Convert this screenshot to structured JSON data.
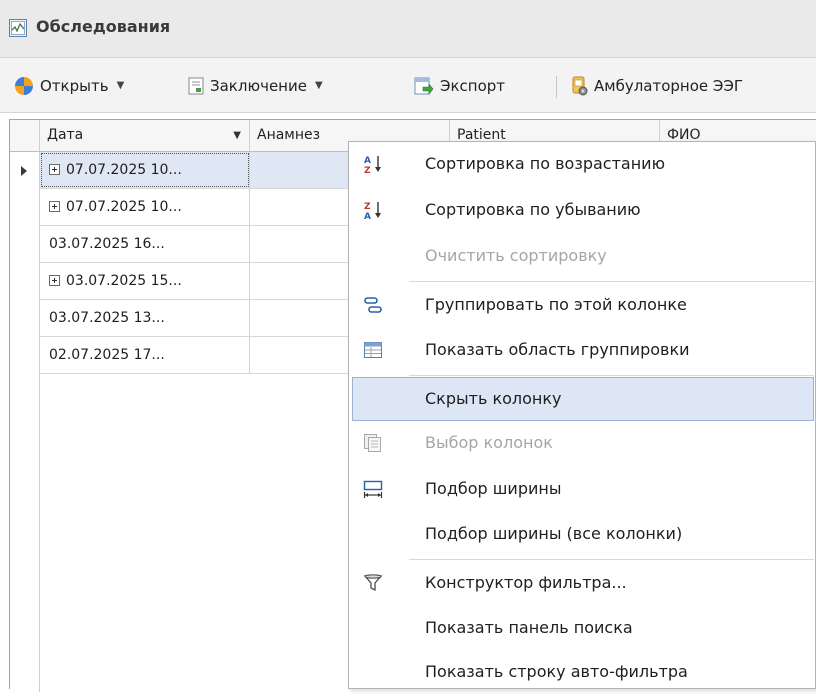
{
  "window": {
    "title": "Обследования",
    "title_icon": "examination-window-icon"
  },
  "toolbar": {
    "open_label": "Открыть",
    "conclusion_label": "Заключение",
    "export_label": "Экспорт",
    "ambulatory_label": "Амбулаторное ЭЭГ"
  },
  "grid": {
    "columns": {
      "date": "Дата",
      "anamnesis": "Анамнез",
      "col3": "Patient",
      "col4": "ФИО"
    },
    "rows": [
      {
        "date": "07.07.2025 10...",
        "expandable": true,
        "selected": true
      },
      {
        "date": "07.07.2025 10...",
        "expandable": true,
        "selected": false
      },
      {
        "date": "03.07.2025 16...",
        "expandable": false,
        "selected": false
      },
      {
        "date": "03.07.2025 15...",
        "expandable": true,
        "selected": false
      },
      {
        "date": "03.07.2025 13...",
        "expandable": false,
        "selected": false
      },
      {
        "date": "02.07.2025 17...",
        "expandable": false,
        "selected": false
      }
    ]
  },
  "context_menu": {
    "sort_asc": "Сортировка по возрастанию",
    "sort_desc": "Сортировка по убыванию",
    "clear_sort": "Очистить сортировку",
    "group_by": "Группировать по этой колонке",
    "show_group_panel": "Показать область группировки",
    "hide_column": "Скрыть колонку",
    "column_chooser": "Выбор колонок",
    "best_fit": "Подбор ширины",
    "best_fit_all": "Подбор ширины (все колонки)",
    "filter_editor": "Конструктор фильтра...",
    "show_find_panel": "Показать панель поиска",
    "show_auto_filter_row": "Показать строку авто-фильтра"
  },
  "colors": {
    "selection": "#dfe6f4",
    "menu_hover": "#dde6f4",
    "disabled_text": "#a6a6a6"
  }
}
